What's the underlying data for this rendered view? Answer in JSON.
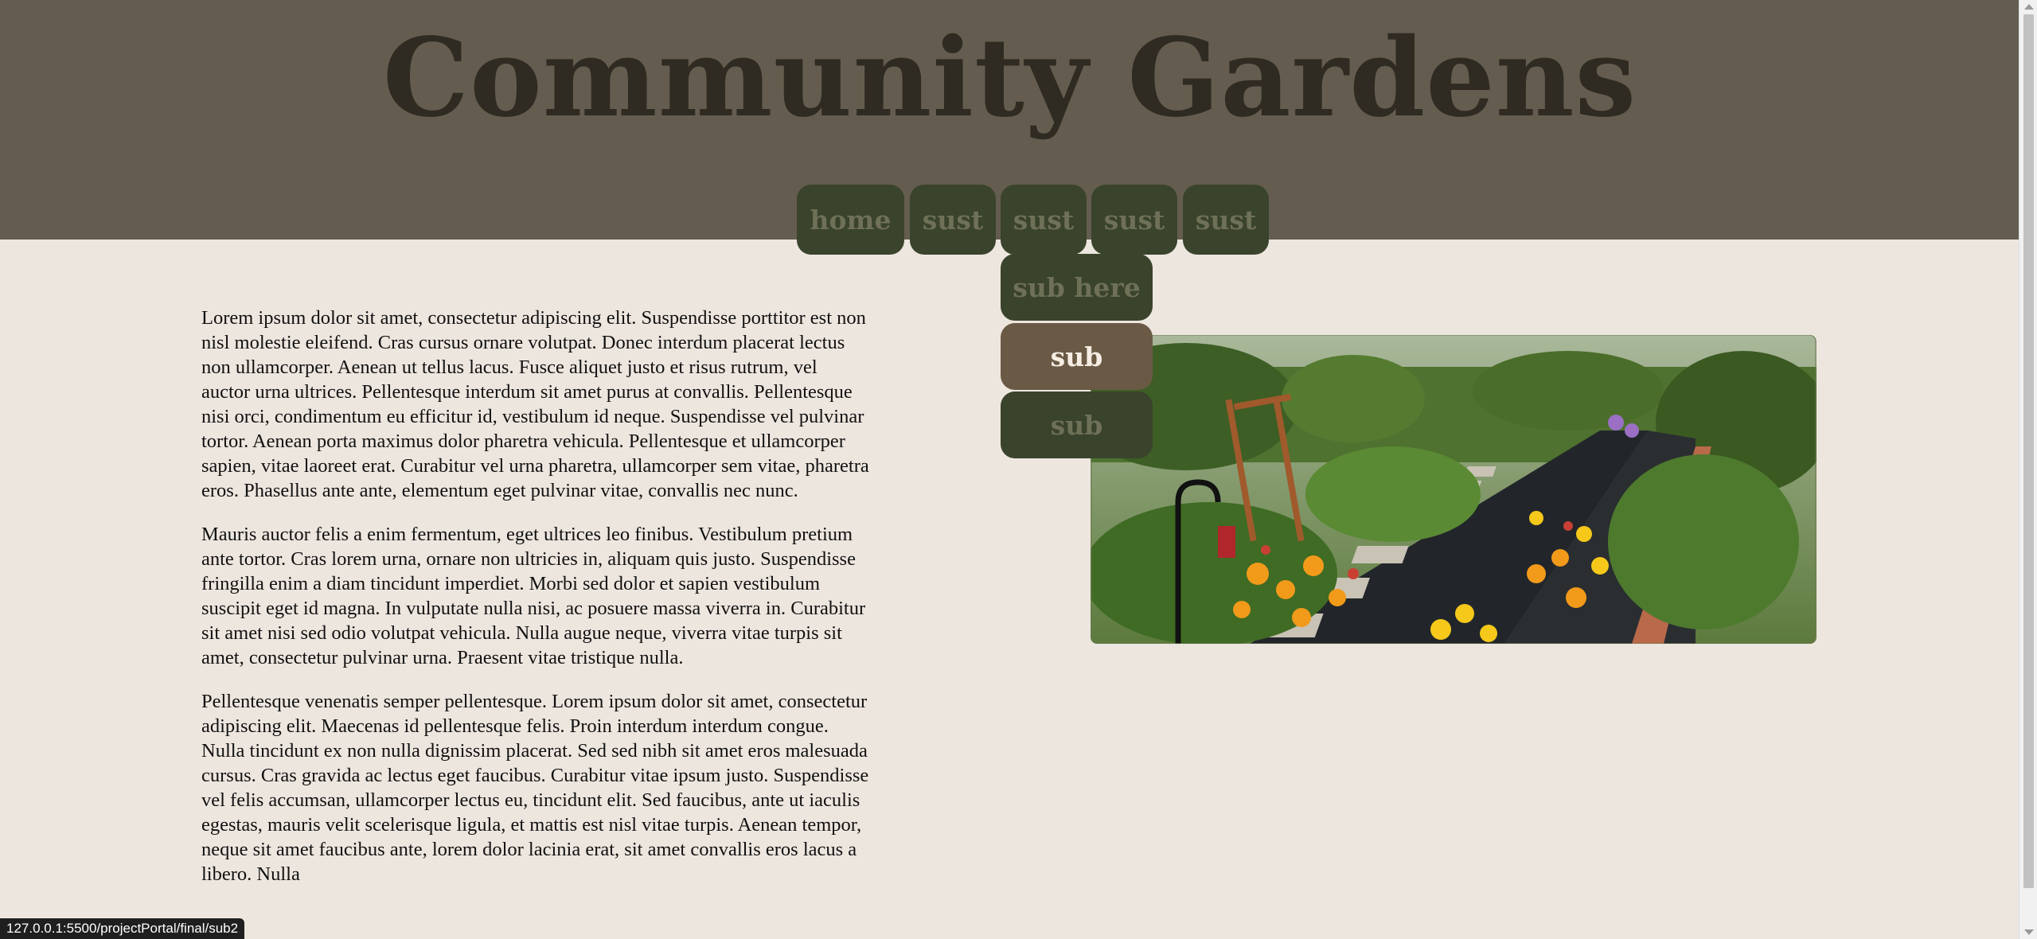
{
  "header": {
    "title": "Community Gardens"
  },
  "nav": {
    "items": [
      {
        "label": "home"
      },
      {
        "label": "sust"
      },
      {
        "label": "sust"
      },
      {
        "label": "sust"
      },
      {
        "label": "sust"
      }
    ],
    "submenu": [
      {
        "label": "sub here"
      },
      {
        "label": "sub"
      },
      {
        "label": "sub"
      }
    ]
  },
  "main": {
    "paragraphs": [
      "Lorem ipsum dolor sit amet, consectetur adipiscing elit. Suspendisse porttitor est non nisl molestie eleifend. Cras cursus ornare volutpat. Donec interdum placerat lectus non ullamcorper. Aenean ut tellus lacus. Fusce aliquet justo et risus rutrum, vel auctor urna ultrices. Pellentesque interdum sit amet purus at convallis. Pellentesque nisi orci, condimentum eu efficitur id, vestibulum id neque. Suspendisse vel pulvinar tortor. Aenean porta maximus dolor pharetra vehicula. Pellentesque et ullamcorper sapien, vitae laoreet erat. Curabitur vel urna pharetra, ullamcorper sem vitae, pharetra eros. Phasellus ante ante, elementum eget pulvinar vitae, convallis nec nunc.",
      "Mauris auctor felis a enim fermentum, eget ultrices leo finibus. Vestibulum pretium ante tortor. Cras lorem urna, ornare non ultricies in, aliquam quis justo. Suspendisse fringilla enim a diam tincidunt imperdiet. Morbi sed dolor et sapien vestibulum suscipit eget id magna. In vulputate nulla nisi, ac posuere massa viverra in. Curabitur sit amet nisi sed odio volutpat vehicula. Nulla augue neque, viverra vitae turpis sit amet, consectetur pulvinar urna. Praesent vitae tristique nulla.",
      "Pellentesque venenatis semper pellentesque. Lorem ipsum dolor sit amet, consectetur adipiscing elit. Maecenas id pellentesque felis. Proin interdum interdum congue. Nulla tincidunt ex non nulla dignissim placerat. Sed sed nibh sit amet eros malesuada cursus. Cras gravida ac lectus eget faucibus. Curabitur vitae ipsum justo. Suspendisse vel felis accumsan, ullamcorper lectus eu, tincidunt elit. Sed faucibus, ante ut iaculis egestas, mauris velit scelerisque ligula, et mattis est nisl vitae turpis. Aenean tempor, neque sit amet faucibus ante, lorem dolor lacinia erat, sit amet convallis eros lacus a libero. Nulla"
    ]
  },
  "status_bar": {
    "url": "127.0.0.1:5500/projectPortal/final/sub2"
  },
  "colors": {
    "header_bg": "#645d4f",
    "page_bg": "#ede6df",
    "nav_bg": "#3a432c",
    "nav_active_bg": "#6a5a45",
    "title_color": "#2f2b22"
  }
}
